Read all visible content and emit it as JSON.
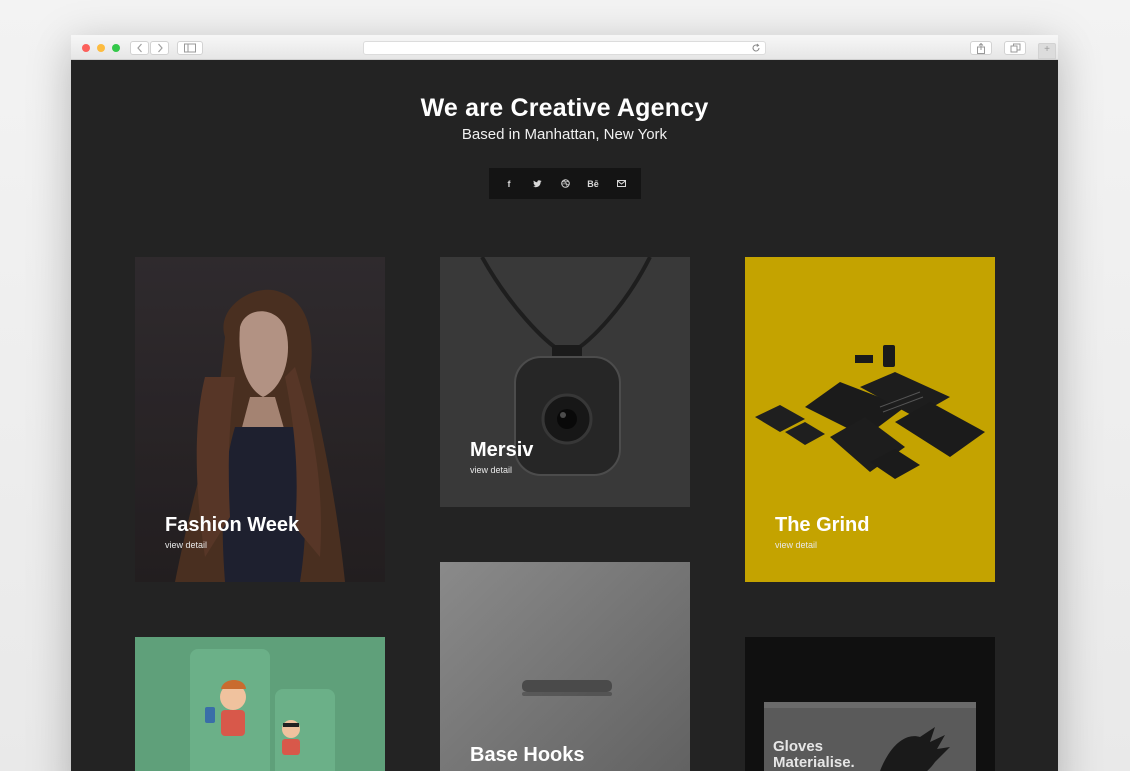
{
  "browser": {
    "traffic_lights": [
      "#fc605b",
      "#fdbc40",
      "#34c84a"
    ],
    "nav_icons": [
      "back-arrow-icon",
      "forward-arrow-icon",
      "sidebar-icon"
    ],
    "right_icons": [
      "share-icon",
      "tabs-icon",
      "new-tab-icon"
    ],
    "new_tab_label": "+"
  },
  "hero": {
    "title": "We are Creative Agency",
    "subtitle": "Based in Manhattan, New York"
  },
  "social": [
    {
      "icon": "facebook-icon",
      "label": "f"
    },
    {
      "icon": "twitter-icon",
      "label": ""
    },
    {
      "icon": "dribbble-icon",
      "label": ""
    },
    {
      "icon": "behance-icon",
      "label": "Bē"
    },
    {
      "icon": "mail-icon",
      "label": ""
    }
  ],
  "cards": [
    {
      "title": "Fashion Week",
      "link": "view detail",
      "color": "#2e2a2c"
    },
    {
      "title": "Mersiv",
      "link": "view detail",
      "color": "#3f3f3f"
    },
    {
      "title": "The Grind",
      "link": "view detail",
      "color": "#c9a700"
    },
    {
      "title": "",
      "link": "",
      "color": "#5fa17a"
    },
    {
      "title": "Base Hooks",
      "link": "",
      "color": "#6e6e6e"
    },
    {
      "title": "",
      "link": "",
      "color": "#0f0f0f",
      "inner_text_line1": "Gloves",
      "inner_text_line2": "Materialise."
    }
  ]
}
